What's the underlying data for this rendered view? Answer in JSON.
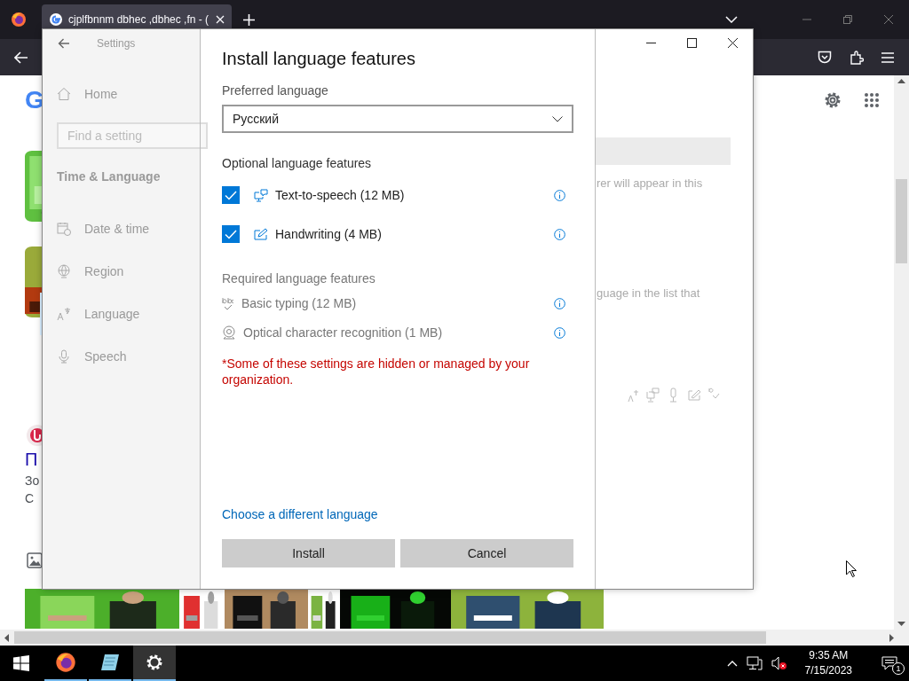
{
  "browser": {
    "tab_title": "cjplfbnnm dbhec ,dbhec ,fn - (",
    "page": {
      "logo_letter": "G",
      "link": "П",
      "snippet_lines": [
        "Зо",
        "С"
      ]
    }
  },
  "settings_window": {
    "title": "Settings",
    "home": "Home",
    "search": {
      "placeholder": "Find a setting"
    },
    "section": "Time & Language",
    "nav": [
      {
        "label": "Date & time",
        "kind": "date",
        "selected": false
      },
      {
        "label": "Region",
        "kind": "region",
        "selected": false
      },
      {
        "label": "Language",
        "kind": "language",
        "selected": true
      },
      {
        "label": "Speech",
        "kind": "speech",
        "selected": false
      }
    ],
    "behind_texts": [
      "rer will appear in this",
      "guage in the list that"
    ]
  },
  "dialog": {
    "title": "Install language features",
    "preferred_label": "Preferred language",
    "language": "Русский",
    "optional_heading": "Optional language features",
    "optional": [
      {
        "label": "Text-to-speech (12 MB)",
        "kind": "speech",
        "checked": true
      },
      {
        "label": "Handwriting (4 MB)",
        "kind": "handwriting",
        "checked": true
      }
    ],
    "required_heading": "Required language features",
    "required": [
      {
        "label": "Basic typing (12 MB)",
        "kind": "typing"
      },
      {
        "label": "Optical character recognition (1 MB)",
        "kind": "ocr"
      }
    ],
    "warning": "*Some of these settings are hidden or managed by your organization.",
    "link": "Choose a different language",
    "buttons": [
      "Install",
      "Cancel"
    ]
  },
  "taskbar": {
    "time": "9:35 AM",
    "date": "7/15/2023",
    "notifications": "1"
  }
}
